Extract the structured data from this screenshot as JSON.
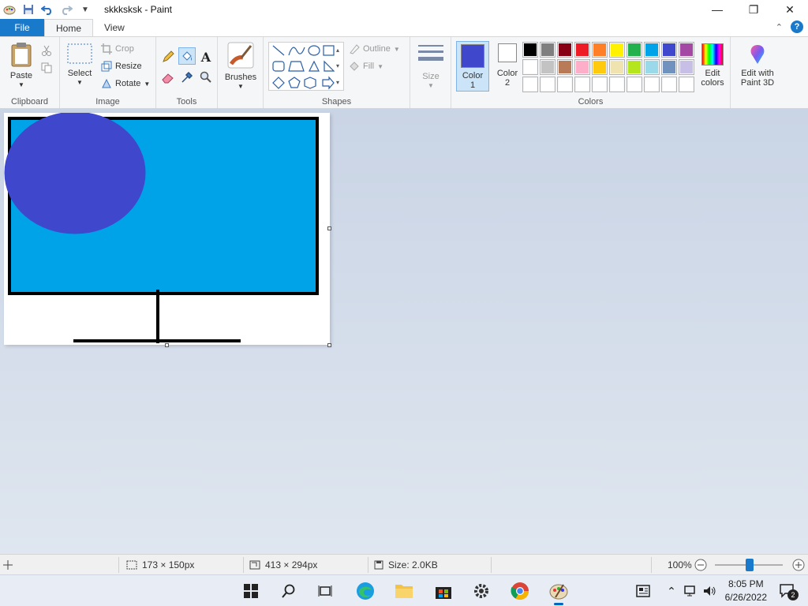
{
  "window": {
    "title": "skkksksk - Paint",
    "controls": {
      "minimize": "—",
      "maximize": "❐",
      "close": "✕"
    }
  },
  "tabs": {
    "file": "File",
    "home": "Home",
    "view": "View"
  },
  "ribbon": {
    "clipboard": {
      "paste": "Paste",
      "label": "Clipboard"
    },
    "image": {
      "select": "Select",
      "crop": "Crop",
      "resize": "Resize",
      "rotate": "Rotate",
      "label": "Image"
    },
    "tools": {
      "label": "Tools"
    },
    "brushes": {
      "label": "Brushes"
    },
    "shapes": {
      "outline": "Outline",
      "fill": "Fill",
      "label": "Shapes"
    },
    "size": {
      "label": "Size"
    },
    "colors": {
      "color1": "Color 1",
      "color2": "Color 2",
      "edit_colors": "Edit colors",
      "paint3d": "Edit with Paint 3D",
      "label": "Colors",
      "color1_value": "#3f48cc",
      "color2_value": "#ffffff",
      "palette_row1": [
        "#000000",
        "#7f7f7f",
        "#880015",
        "#ed1c24",
        "#ff7f27",
        "#fff200",
        "#22b14c",
        "#00a2e8",
        "#3f48cc",
        "#a349a4"
      ],
      "palette_row2": [
        "#ffffff",
        "#c3c3c3",
        "#b97a57",
        "#ffaec9",
        "#ffc90e",
        "#efe4b0",
        "#b5e61d",
        "#99d9ea",
        "#7092be",
        "#c8bfe7"
      ],
      "palette_row3": [
        "#ffffff",
        "#ffffff",
        "#ffffff",
        "#ffffff",
        "#ffffff",
        "#ffffff",
        "#ffffff",
        "#ffffff",
        "#ffffff",
        "#ffffff"
      ]
    }
  },
  "drawing": {
    "screen_fill": "#00a2e8",
    "frame_color": "#000000",
    "circle_fill": "#3f48cc"
  },
  "status": {
    "selection_size": "173 × 150px",
    "canvas_size": "413 × 294px",
    "file_size": "Size: 2.0KB",
    "zoom": "100%"
  },
  "taskbar": {
    "time": "8:05 PM",
    "date": "6/26/2022",
    "notifications": "2"
  }
}
